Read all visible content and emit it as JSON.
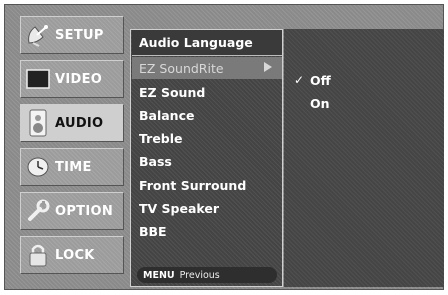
{
  "sidebar": {
    "items": [
      {
        "label": "SETUP",
        "icon": "satellite-dish-icon",
        "active": false
      },
      {
        "label": "VIDEO",
        "icon": "tv-screen-icon",
        "active": false
      },
      {
        "label": "AUDIO",
        "icon": "speaker-icon",
        "active": true
      },
      {
        "label": "TIME",
        "icon": "clock-icon",
        "active": false
      },
      {
        "label": "OPTION",
        "icon": "wrench-icon",
        "active": false
      },
      {
        "label": "LOCK",
        "icon": "padlock-icon",
        "active": false
      }
    ]
  },
  "submenu": {
    "items": [
      {
        "label": "Audio Language"
      },
      {
        "label": "EZ SoundRite",
        "selected": true
      },
      {
        "label": "EZ Sound"
      },
      {
        "label": "Balance"
      },
      {
        "label": "Treble"
      },
      {
        "label": "Bass"
      },
      {
        "label": "Front Surround"
      },
      {
        "label": "TV Speaker"
      },
      {
        "label": "BBE"
      }
    ],
    "footer_key": "MENU",
    "footer_action": "Previous"
  },
  "options": {
    "items": [
      {
        "label": "Off",
        "checked": true
      },
      {
        "label": "On",
        "checked": false
      }
    ]
  },
  "colors": {
    "background": "#8a8a8a",
    "panel": "#444444",
    "selected": "#7a7a7a",
    "active_tab": "#cfcfcf",
    "text": "#ffffff"
  }
}
